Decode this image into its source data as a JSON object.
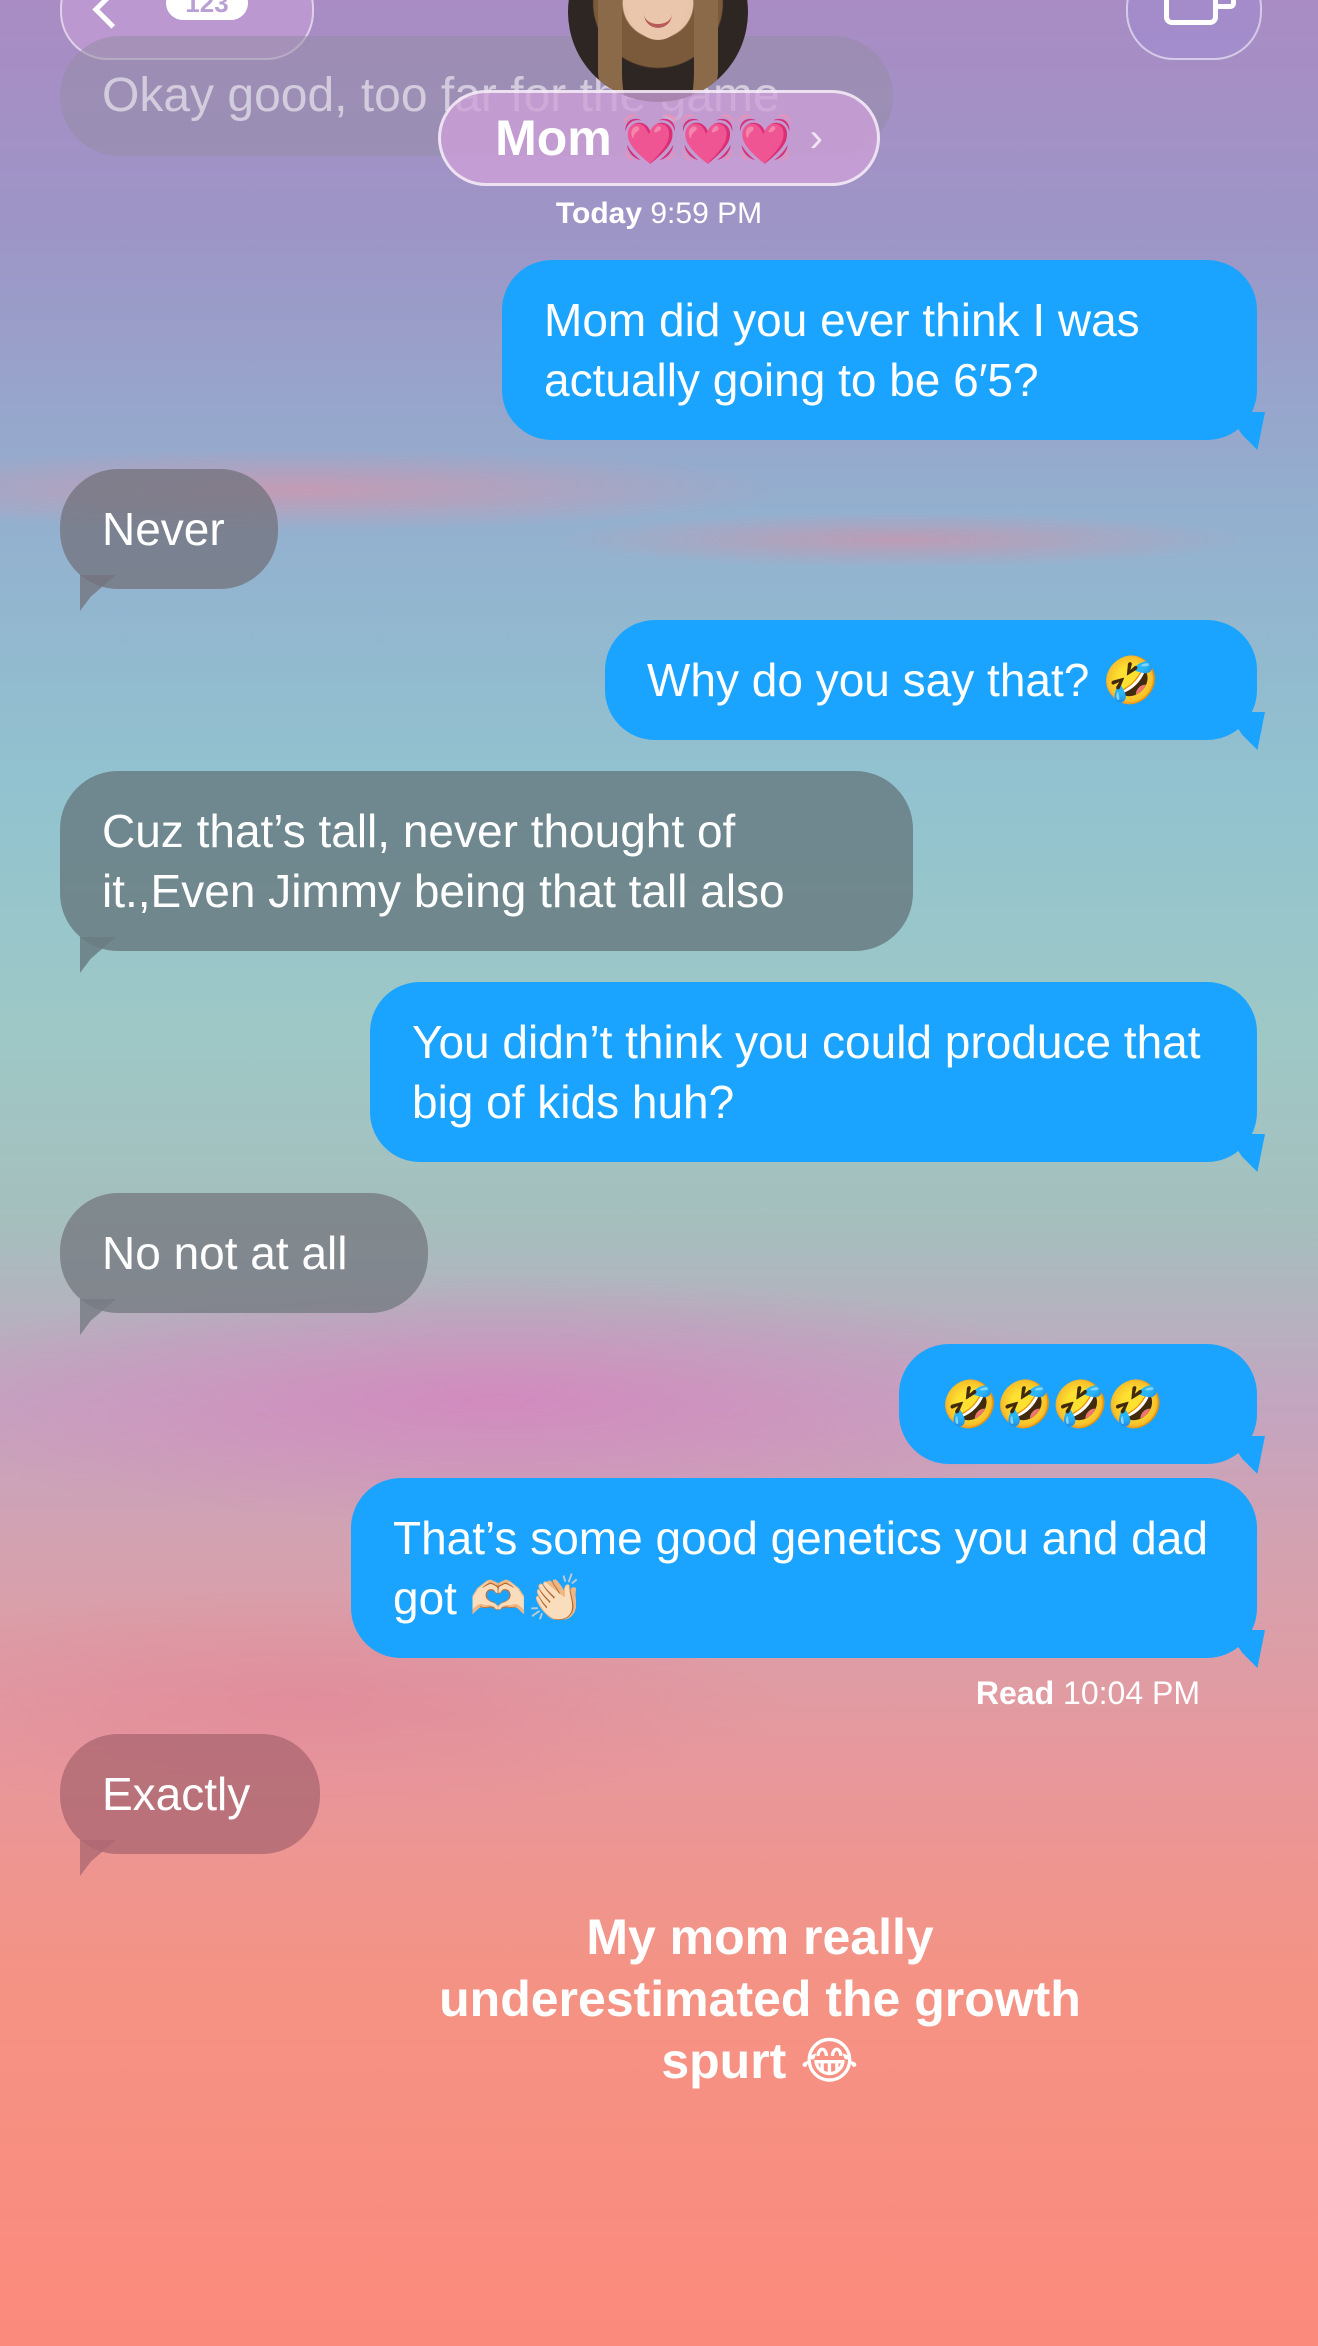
{
  "header": {
    "unread_count": "123",
    "contact_name": "Mom",
    "contact_emoji": "💓💓💓",
    "chevron": "›",
    "back_icon": "chevron-left-icon",
    "video_icon": "video-camera-icon"
  },
  "previous_message": "Okay good, too far for the game",
  "timestamp": {
    "day": "Today",
    "time": "9:59 PM"
  },
  "messages": [
    {
      "from": "me",
      "text": "Mom did you ever think I was actually going to be 6′5?"
    },
    {
      "from": "them",
      "text": "Never"
    },
    {
      "from": "me",
      "text": "Why do you say that? 🤣"
    },
    {
      "from": "them",
      "text": "Cuz that’s tall, never thought of it.,Even Jimmy being that tall also"
    },
    {
      "from": "me",
      "text": "You didn’t think you could produce that big of kids huh?"
    },
    {
      "from": "them",
      "text": "No not at all"
    },
    {
      "from": "me",
      "text": "🤣🤣🤣🤣"
    },
    {
      "from": "me",
      "text": "That’s some good genetics you and dad got 🫶🏻👏🏻"
    },
    {
      "from": "them",
      "text": "Exactly"
    }
  ],
  "read_receipt": {
    "label": "Read",
    "time": "10:04 PM"
  },
  "caption": "My mom really underestimated the growth spurt 😂",
  "colors": {
    "outgoing": "#1aa4ff",
    "incoming": "#7c8a8e"
  }
}
